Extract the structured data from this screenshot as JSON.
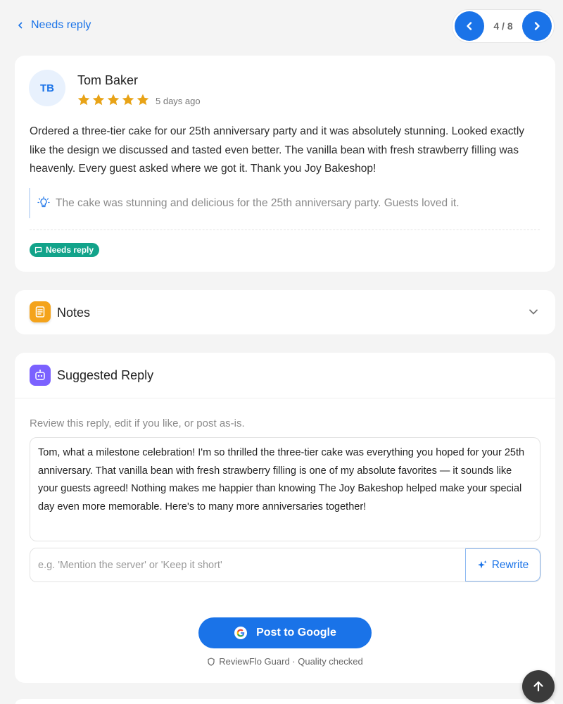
{
  "nav": {
    "back_label": "Needs reply",
    "pager_count": "4 / 8"
  },
  "review": {
    "initials": "TB",
    "reviewer_name": "Tom Baker",
    "rating": 5,
    "max_rating": 5,
    "date": "5 days ago",
    "text": "Ordered a three-tier cake for our 25th anniversary party and it was absolutely stunning. Looked exactly like the design we discussed and tasted even better. The vanilla bean with fresh strawberry filling was heavenly. Every guest asked where we got it. Thank you Joy Bakeshop!",
    "summary": "The cake was stunning and delicious for the 25th anniversary party. Guests loved it.",
    "status": "Needs reply"
  },
  "notes": {
    "title": "Notes"
  },
  "suggested_reply": {
    "title": "Suggested Reply",
    "instructions": "Review this reply, edit if you like, or post as-is.",
    "reply_text": "Tom, what a milestone celebration! I'm so thrilled the three-tier cake was everything you hoped for your 25th anniversary. That vanilla bean with fresh strawberry filling is one of my absolute favorites — it sounds like your guests agreed! Nothing makes me happier than knowing The Joy Bakeshop helped make your special day even more memorable. Here's to many more anniversaries together!",
    "rewrite_placeholder": "e.g. 'Mention the server' or 'Keep it short'",
    "rewrite_value": "",
    "rewrite_label": "Rewrite",
    "post_label": "Post to Google",
    "guard_note": "ReviewFlo Guard · Quality checked"
  },
  "colors": {
    "accent": "#1a73e8",
    "star": "#e8a317",
    "badge": "#12a38a",
    "notes_icon_bg": "#f4a31b",
    "reply_icon_bg": "#7b61ff",
    "scroll_top_bg": "#3a3a3a"
  },
  "icons": {
    "back": "chevron-left-icon",
    "prev": "chevron-left-icon",
    "next": "chevron-right-icon",
    "star": "star-icon",
    "summary": "lightbulb-icon",
    "badge": "message-icon",
    "notes": "notepad-icon",
    "notes_toggle": "chevron-down-icon",
    "reply": "robot-icon",
    "rewrite": "sparkle-icon",
    "post": "google-icon",
    "guard": "shield-icon",
    "scroll_top": "arrow-up-icon"
  }
}
